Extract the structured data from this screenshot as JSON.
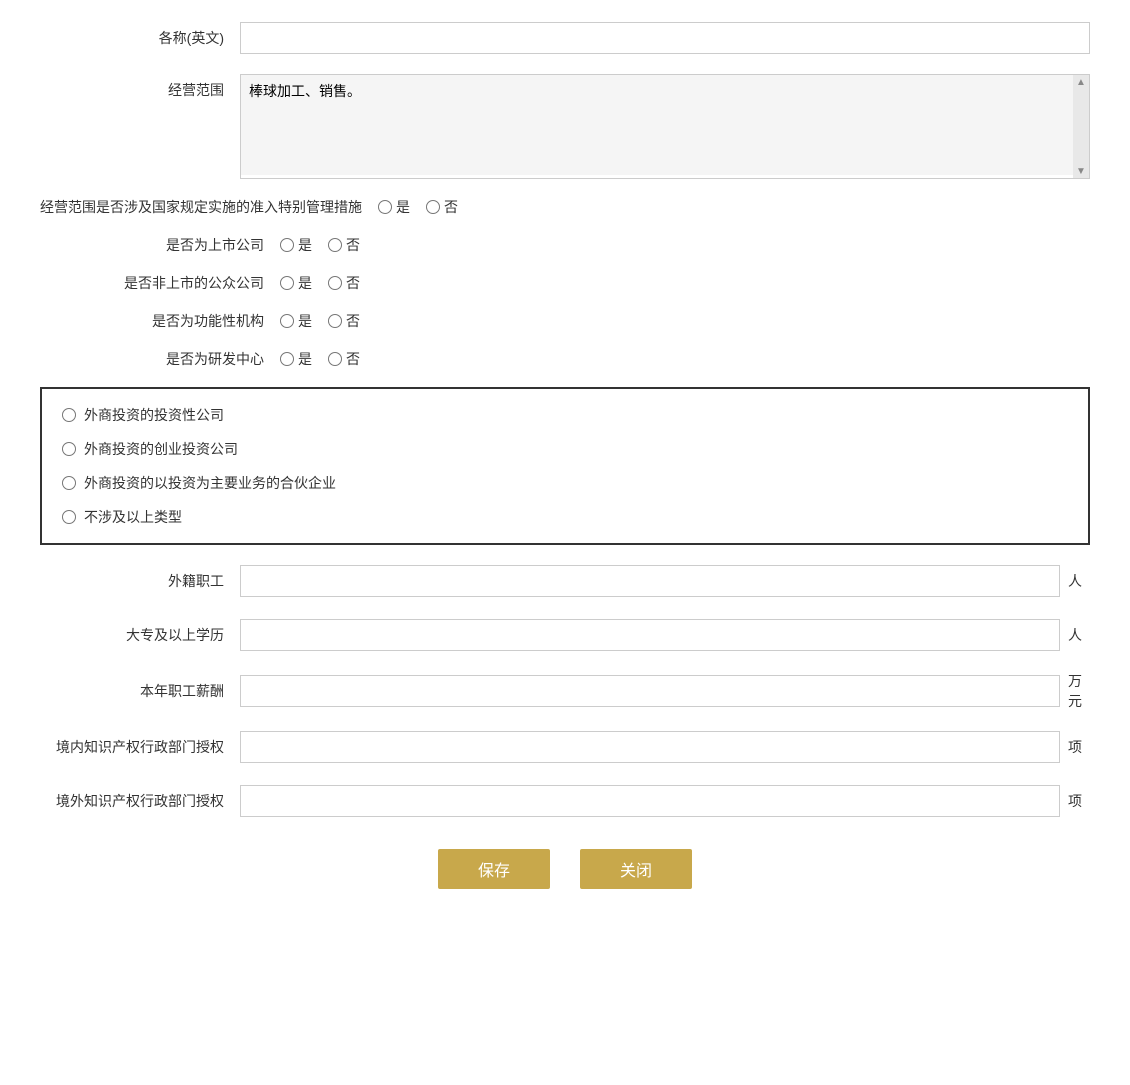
{
  "form": {
    "name_en_label": "各称(英文)",
    "name_en_placeholder": "",
    "business_scope_label": "经营范围",
    "business_scope_value": "棒球加工、销售。",
    "special_mgmt_label": "经营范围是否涉及国家规定实施的准入特别管理措施",
    "special_mgmt_yes": "是",
    "special_mgmt_no": "否",
    "listed_label": "是否为上市公司",
    "listed_yes": "是",
    "listed_no": "否",
    "public_unlisted_label": "是否非上市的公众公司",
    "public_unlisted_yes": "是",
    "public_unlisted_no": "否",
    "functional_org_label": "是否为功能性机构",
    "functional_org_yes": "是",
    "functional_org_no": "否",
    "rd_center_label": "是否为研发中心",
    "rd_center_yes": "是",
    "rd_center_no": "否",
    "investment_type_options": [
      "外商投资的投资性公司",
      "外商投资的创业投资公司",
      "外商投资的以投资为主要业务的合伙企业",
      "不涉及以上类型"
    ],
    "foreign_staff_label": "外籍职工",
    "foreign_staff_unit": "人",
    "foreign_staff_value": "",
    "college_label": "大专及以上学历",
    "college_unit": "人",
    "college_value": "",
    "salary_label": "本年职工薪酬",
    "salary_unit": "万元",
    "salary_value": "",
    "domestic_ip_label": "境内知识产权行政部门授权",
    "domestic_ip_unit": "项",
    "domestic_ip_value": "",
    "foreign_ip_label": "境外知识产权行政部门授权",
    "foreign_ip_unit": "项",
    "foreign_ip_value": "",
    "save_button": "保存",
    "close_button": "关闭"
  }
}
